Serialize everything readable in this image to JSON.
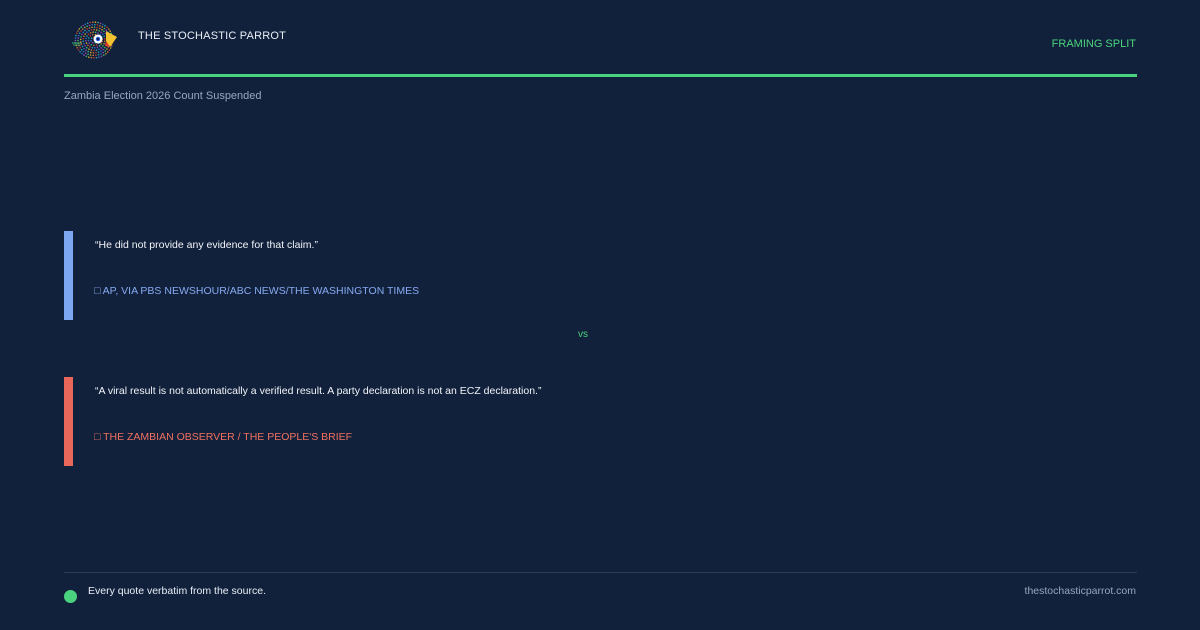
{
  "header": {
    "brand": "THE STOCHASTIC PARROT",
    "tag": "FRAMING SPLIT",
    "subtitle": "Zambia Election 2026 Count Suspended"
  },
  "colors": {
    "background": "#12213b",
    "accent": "#4ad37e",
    "quote_a": "#7ea7f1",
    "quote_b": "#e8675a"
  },
  "quotes": [
    {
      "text": "“He did not provide any evidence for that claim.”",
      "source": "□ AP, VIA PBS NEWSHOUR/ABC NEWS/THE WASHINGTON TIMES"
    },
    {
      "text": "“A viral result is not automatically a verified result. A party declaration is not an ECZ declaration.”",
      "source": "□ THE ZAMBIAN OBSERVER / THE PEOPLE'S BRIEF"
    }
  ],
  "vs_label": "vs",
  "footer": {
    "note": "Every quote verbatim from the source.",
    "site": "thestochasticparrot.com"
  }
}
